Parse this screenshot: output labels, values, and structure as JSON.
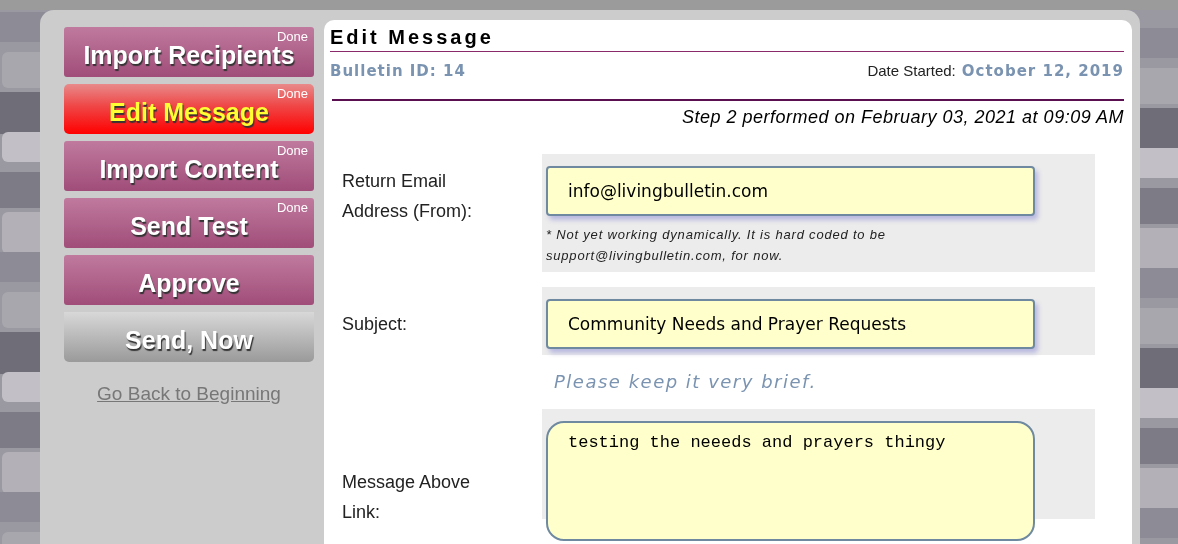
{
  "steps": [
    {
      "label": "Import Recipients",
      "status": "Done",
      "selected": false,
      "disabled": false
    },
    {
      "label": "Edit Message",
      "status": "Done",
      "selected": true,
      "disabled": false
    },
    {
      "label": "Import Content",
      "status": "Done",
      "selected": false,
      "disabled": false
    },
    {
      "label": "Send Test",
      "status": "Done",
      "selected": false,
      "disabled": false
    },
    {
      "label": "Approve",
      "selected": false,
      "disabled": false
    },
    {
      "label": "Send, Now",
      "selected": false,
      "disabled": true
    }
  ],
  "back_link": "Go Back to Beginning",
  "panel": {
    "title": "Edit Message",
    "bulletin_id": "Bulletin ID: 14",
    "date_started_label": "Date Started:",
    "date_started": "October 12, 2019",
    "step_note": "Step 2 performed on February 03, 2021 at 09:09 AM"
  },
  "form": {
    "return_email": {
      "label": "Return Email Address (From):",
      "value": "info@livingbulletin.com",
      "note": "* Not yet working dynamically. It is hard coded to be support@livingbulletin.com, for now."
    },
    "subject": {
      "label": "Subject:",
      "value": "Community Needs and Prayer Requests",
      "hint": "Please keep it very brief."
    },
    "message": {
      "label": "Message Above Link:",
      "value": "testing the neeeds and prayers thingy"
    }
  }
}
